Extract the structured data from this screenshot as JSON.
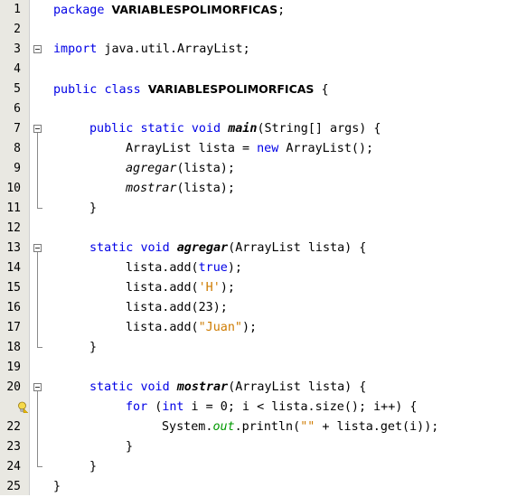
{
  "editor": {
    "highlight_line": 22,
    "lines": [
      {
        "n": "1",
        "indent": 0,
        "tokens": [
          {
            "t": "package",
            "c": "kw"
          },
          {
            "t": " "
          },
          {
            "t": "VARIABLESPOLIMORFICAS",
            "c": "cls"
          },
          {
            "t": ";"
          }
        ]
      },
      {
        "n": "2",
        "indent": 0,
        "tokens": []
      },
      {
        "n": "3",
        "indent": 0,
        "tokens": [
          {
            "t": "import",
            "c": "kw"
          },
          {
            "t": " java.util.ArrayList;"
          }
        ]
      },
      {
        "n": "4",
        "indent": 0,
        "tokens": []
      },
      {
        "n": "5",
        "indent": 0,
        "tokens": [
          {
            "t": "public",
            "c": "kw"
          },
          {
            "t": " "
          },
          {
            "t": "class",
            "c": "kw"
          },
          {
            "t": " "
          },
          {
            "t": "VARIABLESPOLIMORFICAS",
            "c": "cls"
          },
          {
            "t": " {"
          }
        ]
      },
      {
        "n": "6",
        "indent": 0,
        "tokens": []
      },
      {
        "n": "7",
        "indent": 1,
        "tokens": [
          {
            "t": "public",
            "c": "kw"
          },
          {
            "t": " "
          },
          {
            "t": "static",
            "c": "kw"
          },
          {
            "t": " "
          },
          {
            "t": "void",
            "c": "kw"
          },
          {
            "t": " "
          },
          {
            "t": "main",
            "c": "mdecl"
          },
          {
            "t": "(String[] args) {"
          }
        ]
      },
      {
        "n": "8",
        "indent": 2,
        "tokens": [
          {
            "t": "ArrayList lista = "
          },
          {
            "t": "new",
            "c": "kw"
          },
          {
            "t": " ArrayList();"
          }
        ]
      },
      {
        "n": "9",
        "indent": 2,
        "tokens": [
          {
            "t": "agregar",
            "c": "mcall"
          },
          {
            "t": "(lista);"
          }
        ]
      },
      {
        "n": "10",
        "indent": 2,
        "tokens": [
          {
            "t": "mostrar",
            "c": "mcall"
          },
          {
            "t": "(lista);"
          }
        ]
      },
      {
        "n": "11",
        "indent": 1,
        "tokens": [
          {
            "t": "}"
          }
        ]
      },
      {
        "n": "12",
        "indent": 0,
        "tokens": []
      },
      {
        "n": "13",
        "indent": 1,
        "tokens": [
          {
            "t": "static",
            "c": "kw"
          },
          {
            "t": " "
          },
          {
            "t": "void",
            "c": "kw"
          },
          {
            "t": " "
          },
          {
            "t": "agregar",
            "c": "mdecl"
          },
          {
            "t": "(ArrayList lista) {"
          }
        ]
      },
      {
        "n": "14",
        "indent": 2,
        "tokens": [
          {
            "t": "lista.add("
          },
          {
            "t": "true",
            "c": "kw"
          },
          {
            "t": ");"
          }
        ]
      },
      {
        "n": "15",
        "indent": 2,
        "tokens": [
          {
            "t": "lista.add("
          },
          {
            "t": "'H'",
            "c": "str"
          },
          {
            "t": ");"
          }
        ]
      },
      {
        "n": "16",
        "indent": 2,
        "tokens": [
          {
            "t": "lista.add(23);"
          }
        ]
      },
      {
        "n": "17",
        "indent": 2,
        "tokens": [
          {
            "t": "lista.add("
          },
          {
            "t": "\"Juan\"",
            "c": "str"
          },
          {
            "t": ");"
          }
        ]
      },
      {
        "n": "18",
        "indent": 1,
        "tokens": [
          {
            "t": "}"
          }
        ]
      },
      {
        "n": "19",
        "indent": 0,
        "tokens": []
      },
      {
        "n": "20",
        "indent": 1,
        "tokens": [
          {
            "t": "static",
            "c": "kw"
          },
          {
            "t": " "
          },
          {
            "t": "void",
            "c": "kw"
          },
          {
            "t": " "
          },
          {
            "t": "mostrar",
            "c": "mdecl"
          },
          {
            "t": "(ArrayList lista) {"
          }
        ]
      },
      {
        "n": "",
        "indent": 2,
        "tokens": [
          {
            "t": "for",
            "c": "kw"
          },
          {
            "t": " ("
          },
          {
            "t": "int",
            "c": "kw"
          },
          {
            "t": " i = 0; i < lista.size(); i++) {"
          }
        ]
      },
      {
        "n": "22",
        "indent": 3,
        "tokens": [
          {
            "t": "System."
          },
          {
            "t": "out",
            "c": "field"
          },
          {
            "t": ".println("
          },
          {
            "t": "\"\"",
            "c": "str"
          },
          {
            "t": " + lista.get(i));"
          }
        ]
      },
      {
        "n": "23",
        "indent": 2,
        "tokens": [
          {
            "t": "}"
          }
        ]
      },
      {
        "n": "24",
        "indent": 1,
        "tokens": [
          {
            "t": "}"
          }
        ]
      },
      {
        "n": "25",
        "indent": 0,
        "tokens": [
          {
            "t": "}"
          }
        ]
      }
    ]
  },
  "gutter_icons": {
    "line_21": "lightbulb-warning-icon",
    "fold": "fold-collapse-icon"
  }
}
